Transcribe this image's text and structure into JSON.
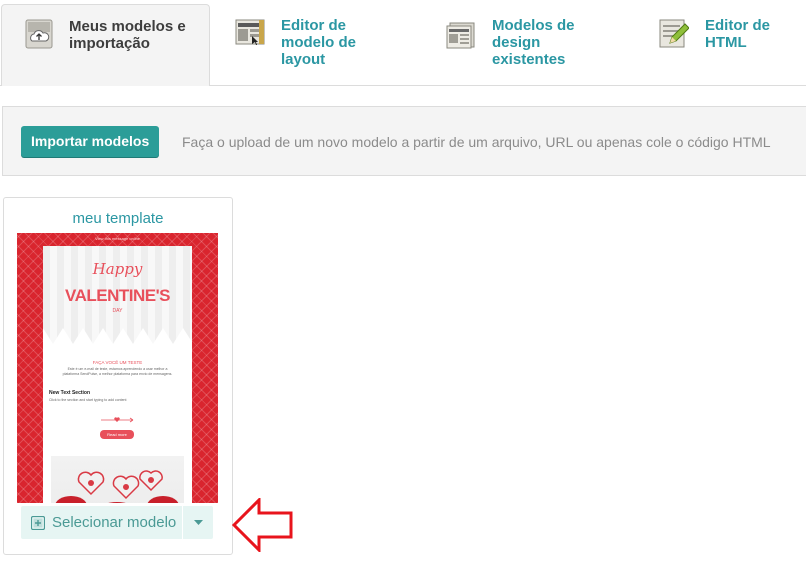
{
  "tabs": [
    {
      "label": "Meus modelos e importação",
      "icon": "upload-cloud-icon",
      "active": true
    },
    {
      "label": "Editor de modelo de layout",
      "icon": "layout-editor-icon",
      "active": false
    },
    {
      "label": "Modelos de design existentes",
      "icon": "newspaper-icon",
      "active": false
    },
    {
      "label": "Editor de HTML",
      "icon": "pencil-document-icon",
      "active": false
    }
  ],
  "import": {
    "button_label": "Importar modelos",
    "description": "Faça o upload de um novo modelo a partir de um arquivo, URL ou apenas cole o código HTML"
  },
  "template_card": {
    "title": "meu template",
    "preview": {
      "top_link": "View this message online",
      "happy": "Happy",
      "valentines": "VALENTINE'S",
      "day": "DAY",
      "heading": "FAÇA VOCÊ UM TESTE",
      "body": "Este é um e-mail de teste, estamos aprendendo a usar melhor a plataforma SendPulse, a melhor plataforma para envio de mensagens.",
      "section_title": "New Text Section",
      "section_text": "Click to the section and start typing to add content",
      "read_more": "Read more"
    },
    "select_label": "Selecionar modelo"
  },
  "colors": {
    "accent": "#2b97a3",
    "button_teal": "#2b9d98",
    "annotation_red": "#e8141c",
    "valentine_red": "#d9252e"
  }
}
